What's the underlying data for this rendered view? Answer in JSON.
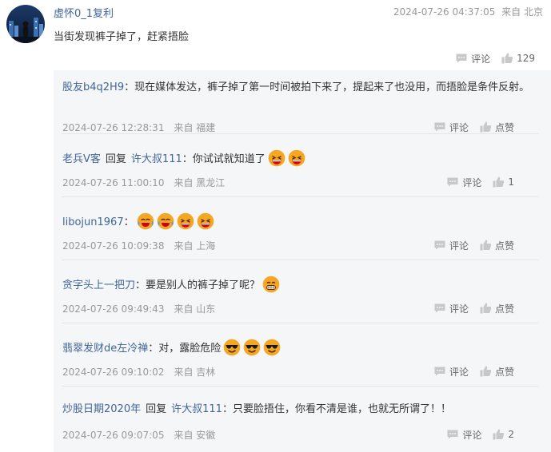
{
  "main_comment": {
    "username": "虚怀0_1复利",
    "datetime": "2024-07-26 04:37:05",
    "location": "来自 北京",
    "text": "当街发现裤子掉了，赶紧捂脸",
    "comment_label": "评论",
    "like_count": "129"
  },
  "replies": [
    {
      "user": "股友b4q2H9",
      "reply_word": "",
      "target": "",
      "text": "：现在媒体发达，裤子掉了第一时间被拍下来了，提起来了也没用，而捂脸是条件反射。",
      "emojis": [],
      "datetime": "2024-07-26 12:28:31",
      "location": "来自 福建",
      "comment_label": "评论",
      "like_label": "点赞"
    },
    {
      "user": "老兵V客",
      "reply_word": "回复",
      "target": "许大叔111",
      "text": "：你试试就知道了",
      "emojis": [
        "laughing-emoji",
        "laughing-emoji"
      ],
      "datetime": "2024-07-26 11:00:10",
      "location": "来自 黑龙江",
      "comment_label": "评论",
      "like_label": "1"
    },
    {
      "user": "libojun1967",
      "reply_word": "",
      "target": "",
      "text": "：",
      "emojis": [
        "crying-laughing-emoji",
        "crying-laughing-emoji",
        "laughing-emoji",
        "laughing-emoji"
      ],
      "datetime": "2024-07-26 10:09:38",
      "location": "来自 上海",
      "comment_label": "评论",
      "like_label": "点赞"
    },
    {
      "user": "贪字头上一把刀",
      "reply_word": "",
      "target": "",
      "text": "：要是别人的裤子掉了呢？",
      "emojis": [
        "grinning-emoji"
      ],
      "datetime": "2024-07-26 09:49:43",
      "location": "来自 山东",
      "comment_label": "评论",
      "like_label": "点赞"
    },
    {
      "user": "翡翠发财de左冷禅",
      "reply_word": "",
      "target": "",
      "text": "：对，露脸危险",
      "emojis": [
        "sunglasses-emoji",
        "sunglasses-emoji",
        "sunglasses-emoji"
      ],
      "datetime": "2024-07-26 09:10:02",
      "location": "来自 吉林",
      "comment_label": "评论",
      "like_label": "点赞"
    },
    {
      "user": "炒股日期2020年",
      "reply_word": "回复",
      "target": "许大叔111",
      "text": "：只要脸捂住，你看不清是谁，也就无所谓了！！",
      "emojis": [],
      "datetime": "2024-07-26 09:07:05",
      "location": "来自 安徽",
      "comment_label": "评论",
      "like_label": "2"
    }
  ],
  "colors": {
    "username": "#406599",
    "meta": "#999999",
    "reply_bg": "#f5f6f7",
    "icon": "#c8c8c8",
    "emoji_face": "#f5a623",
    "emoji_mouth": "#d0021b"
  }
}
